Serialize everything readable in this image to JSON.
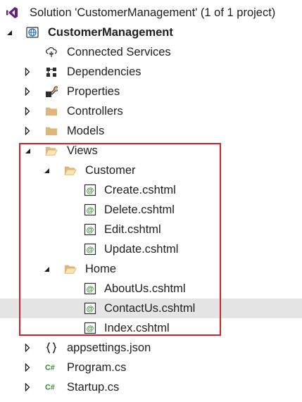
{
  "solution": {
    "label": "Solution 'CustomerManagement' (1 of 1 project)",
    "icon": "visual-studio-solution-icon"
  },
  "project": {
    "label": "CustomerManagement",
    "icon": "web-project-globe-icon"
  },
  "items": {
    "connected_services": "Connected Services",
    "dependencies": "Dependencies",
    "properties": "Properties",
    "controllers": "Controllers",
    "models": "Models",
    "views": "Views",
    "customer": "Customer",
    "create": "Create.cshtml",
    "delete": "Delete.cshtml",
    "edit": "Edit.cshtml",
    "update": "Update.cshtml",
    "home": "Home",
    "aboutus": "AboutUs.cshtml",
    "contactus": "ContactUs.cshtml",
    "index": "Index.cshtml",
    "appsettings": "appsettings.json",
    "program": "Program.cs",
    "startup": "Startup.cs"
  },
  "highlight_color": "#d61f2b",
  "hover_row": "ContactUs.cshtml"
}
